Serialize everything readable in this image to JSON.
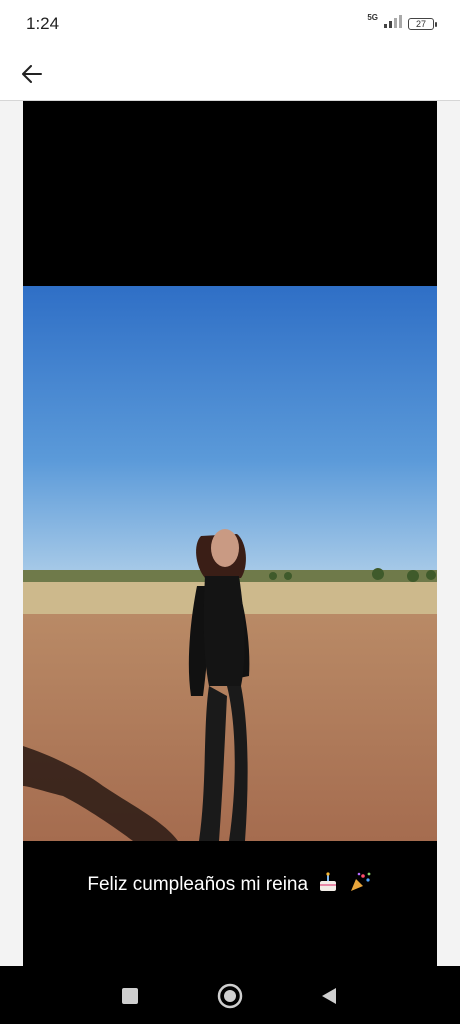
{
  "status_bar": {
    "time": "1:24",
    "network": "5G",
    "battery": "27"
  },
  "story": {
    "caption": "Feliz cumpleaños mi reina",
    "emojis": [
      "cake-icon",
      "confetti-icon"
    ]
  },
  "icons": {
    "back": "arrow-left-icon",
    "nav_recents": "square-icon",
    "nav_home": "circle-icon",
    "nav_back": "triangle-back-icon"
  }
}
